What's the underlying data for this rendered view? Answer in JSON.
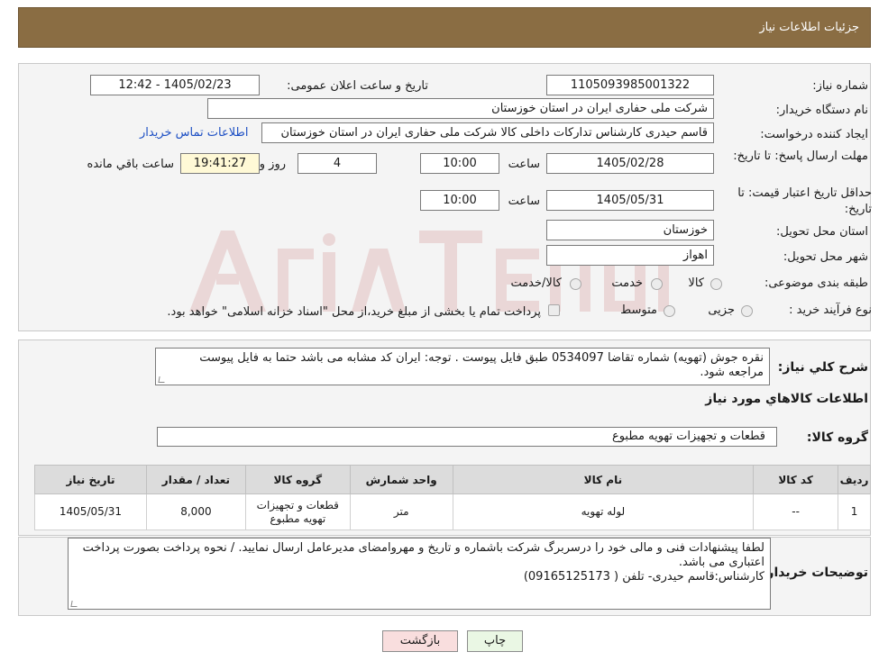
{
  "header": {
    "title": "جزئیات اطلاعات نیاز"
  },
  "form": {
    "need_number_label": "شماره نیاز:",
    "need_number": "1105093985001322",
    "announce_label": "تاریخ و ساعت اعلان عمومی:",
    "announce_value": "1405/02/23 - 12:42",
    "buyer_org_label": "نام دستگاه خریدار:",
    "buyer_org": "شرکت ملی حفاری ایران در استان خوزستان",
    "creator_label": "ایجاد کننده درخواست:",
    "creator": "قاسم حیدری کارشناس تدارکات داخلی کالا شرکت ملی حفاری ایران در استان خوزستان",
    "contact_link": "اطلاعات تماس خریدار",
    "deadline_label": "مهلت ارسال پاسخ: تا تاریخ:",
    "deadline_date": "1405/02/28",
    "time_label": "ساعت",
    "deadline_time": "10:00",
    "days_value": "4",
    "days_label": "روز و",
    "remaining_time": "19:41:27",
    "remaining_label": "ساعت باقي مانده",
    "validity_label": "حداقل تاریخ اعتبار قیمت: تا تاریخ:",
    "validity_date": "1405/05/31",
    "validity_time": "10:00",
    "province_label": "استان محل تحویل:",
    "province": "خوزستان",
    "city_label": "شهر محل تحویل:",
    "city": "اهواز",
    "category_label": "طبقه بندی موضوعی:",
    "category_options": [
      "کالا",
      "خدمت",
      "کالا/خدمت"
    ],
    "purchase_type_label": "نوع فرآیند خرید :",
    "purchase_options": [
      "جزیی",
      "متوسط"
    ],
    "purchase_note": "پرداخت تمام یا بخشی از مبلغ خرید،از محل \"اسناد خزانه اسلامی\" خواهد بود."
  },
  "summary": {
    "label": "شرح کلي نياز:",
    "text": "نقره جوش (تهویه)  شماره تقاضا 0534097 طبق فایل پیوست . توجه: ایران کد مشابه می باشد حتما به فایل پیوست مراجعه شود.",
    "goods_info_title": "اطلاعات کالاهاي مورد نياز",
    "group_label": "گروه کالا:",
    "group_value": "قطعات و تجهیزات تهویه مطبوع"
  },
  "table": {
    "headers": [
      "رديف",
      "کد کالا",
      "نام کالا",
      "واحد شمارش",
      "گروه کالا",
      "تعداد / مقدار",
      "تاریخ نیاز"
    ],
    "rows": [
      [
        "1",
        "--",
        "لوله تهویه",
        "متر",
        "قطعات و تجهیزات تهویه مطبوع",
        "8,000",
        "1405/05/31"
      ]
    ]
  },
  "buyer_notes": {
    "label": "توضيحات خريدار:",
    "line1": "لطفا پیشنهادات فنی و مالی خود را درسربرگ شرکت باشماره و تاریخ و مهروامضای مدیرعامل ارسال نمایید. / نحوه پرداخت بصورت پرداخت اعتباری می باشد.",
    "line2": "کارشناس:قاسم حیدری- تلفن ( 09165125173)"
  },
  "buttons": {
    "print": "چاپ",
    "back": "بازگشت"
  },
  "colors": {
    "header_bg": "#8a6d43",
    "link": "#1d4fc4"
  }
}
